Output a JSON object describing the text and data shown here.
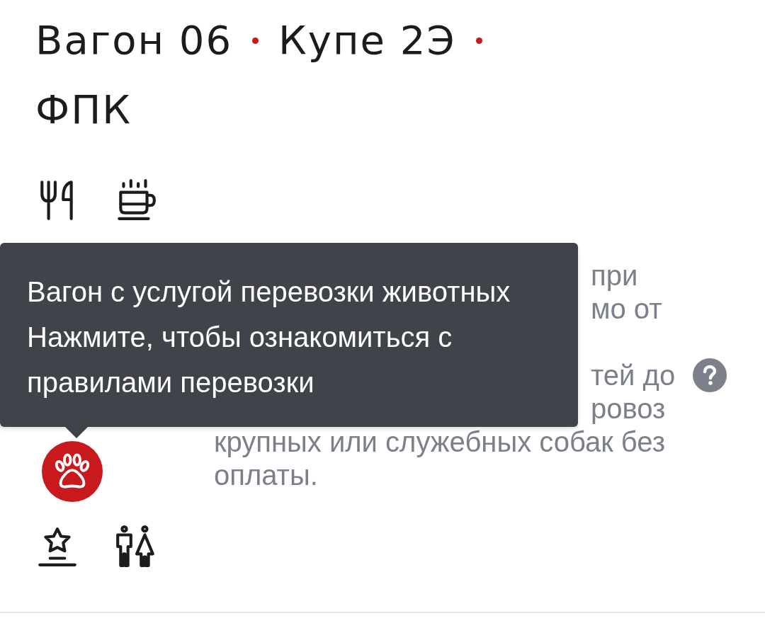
{
  "header": {
    "title_parts": [
      {
        "text": "Вагон 06",
        "separator_after": true
      },
      {
        "text": "Купе 2Э",
        "separator_after": true
      },
      {
        "text": "ФПК",
        "separator_after": false
      }
    ]
  },
  "amenity_rows": [
    [
      {
        "kind": "dining",
        "highlighted": false
      },
      {
        "kind": "coffee",
        "highlighted": false
      }
    ],
    [
      {
        "kind": "pets",
        "highlighted": true
      }
    ],
    [
      {
        "kind": "premium",
        "highlighted": false
      },
      {
        "kind": "toilet",
        "highlighted": false
      }
    ]
  ],
  "note": {
    "line_ends_beside_tooltip": [
      "при",
      "мо от",
      "тей до",
      "ровоз"
    ],
    "lines_below_tooltip": [
      "крупных или служебных собак без",
      "оплаты."
    ]
  },
  "tooltip": {
    "title": "Вагон с услугой перевозки животных",
    "text": "Нажмите, чтобы ознакомиться с правилами перевозки"
  }
}
